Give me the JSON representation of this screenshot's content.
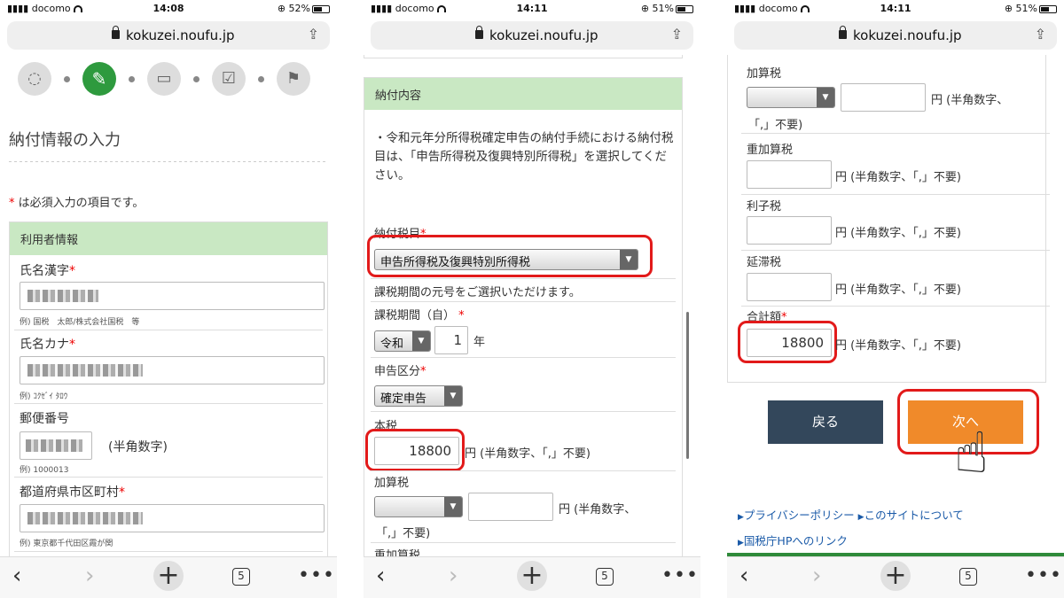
{
  "common": {
    "url": "kokuzei.noufu.jp",
    "carrier": "docomo",
    "tabs_count": "5",
    "more": "•••"
  },
  "p1": {
    "time": "14:08",
    "battery": "52%",
    "title": "納付情報の入力",
    "required_note": "は必須入力の項目です。",
    "section": "利用者情報",
    "name_kanji": "氏名漢字",
    "name_kanji_hint": "例) 国税　太郎/株式会社国税　等",
    "name_kana": "氏名カナ",
    "name_kana_hint": "例) ｺｸｾﾞｲ ﾀﾛｳ",
    "postal": "郵便番号",
    "postal_unit": "(半角数字)",
    "postal_hint": "例) 1000013",
    "pref": "都道府県市区町村",
    "pref_hint": "例) 東京都千代田区霞が関"
  },
  "p2": {
    "time": "14:11",
    "battery": "51%",
    "section": "納付内容",
    "notice": "・令和元年分所得税確定申告の納付手続における納付税目は、「申告所得税及復興特別所得税」を選択してください。",
    "tax_item_label": "納付税目",
    "tax_item_value": "申告所得税及復興特別所得税",
    "era_note": "課税期間の元号をご選択いただけます。",
    "period_label": "課税期間（自）",
    "era_value": "令和",
    "year_value": "1",
    "year_unit": "年",
    "filing_label": "申告区分",
    "filing_value": "確定申告",
    "main_tax_label": "本税",
    "main_tax_value": "18800",
    "unit_text": "円 (半角数字、「,」不要)",
    "unit_text_a": "円 (半角数字、",
    "unit_text_b": "「,」不要)",
    "add_tax_label": "加算税",
    "heavy_tax_label": "重加算税"
  },
  "p3": {
    "time": "14:11",
    "battery": "51%",
    "add_tax_label": "加算税",
    "unit_text_a": "円 (半角数字、",
    "unit_text_b": "「,」不要)",
    "heavy_tax_label": "重加算税",
    "interest_label": "利子税",
    "delay_label": "延滞税",
    "total_label": "合計額",
    "total_value": "18800",
    "unit_text": "円 (半角数字、「,」不要)",
    "back_button": "戻る",
    "next_button": "次へ",
    "link_privacy": "プライバシーポリシー",
    "link_about": "このサイトについて",
    "link_nta": "国税庁HPへのリンク"
  }
}
